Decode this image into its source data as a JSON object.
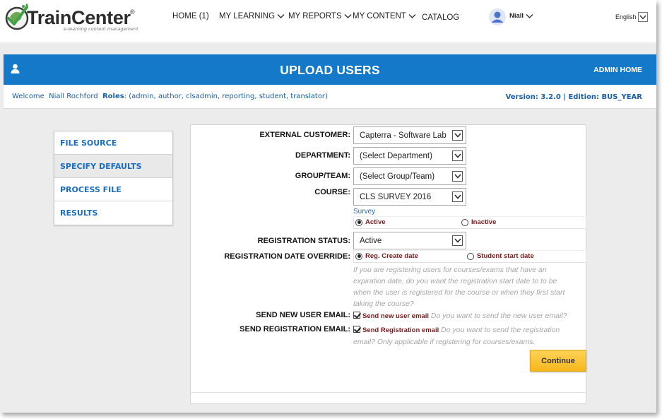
{
  "logo": {
    "wordmark": "TrainCenter",
    "registered": "®",
    "tagline": "e-learning content management"
  },
  "nav": {
    "items": [
      {
        "label": "HOME (1)",
        "dropdown": false
      },
      {
        "label": "MY LEARNING",
        "dropdown": true
      },
      {
        "label": "MY REPORTS",
        "dropdown": true
      },
      {
        "label": "MY CONTENT",
        "dropdown": true
      },
      {
        "label": "CATALOG",
        "dropdown": false
      }
    ],
    "user_name": "Niall",
    "language": "English"
  },
  "banner": {
    "title": "UPLOAD USERS",
    "admin_home": "ADMIN HOME"
  },
  "welcome": {
    "welcome_label": "Welcome",
    "user_full_name": "Niall Rochford",
    "roles_label": "Roles",
    "roles_value": ": (admin, author, clsadmin, reporting, student, translator)",
    "version": "Version: 3.2.0",
    "separator": "|",
    "edition": "Edition: BUS_YEAR"
  },
  "steps": {
    "items": [
      {
        "label": "FILE SOURCE",
        "active": false
      },
      {
        "label": "SPECIFY DEFAULTS",
        "active": true
      },
      {
        "label": "PROCESS FILE",
        "active": false
      },
      {
        "label": "RESULTS",
        "active": false
      }
    ]
  },
  "form": {
    "external_customer": {
      "label": "EXTERNAL CUSTOMER:",
      "value": "Capterra - Software Lab"
    },
    "department": {
      "label": "DEPARTMENT:",
      "value": "(Select Department)"
    },
    "group_team": {
      "label": "GROUP/TEAM:",
      "value": "(Select Group/Team)"
    },
    "course": {
      "label": "COURSE:",
      "value": "CLS SURVEY 2016"
    },
    "survey": {
      "label": "Survey",
      "options": [
        {
          "label": "Active",
          "selected": true
        },
        {
          "label": "Inactive",
          "selected": false
        }
      ]
    },
    "registration_status": {
      "label": "REGISTRATION STATUS:",
      "value": "Active"
    },
    "registration_date_override": {
      "label": "REGISTRATION DATE OVERRIDE:",
      "options": [
        {
          "label": "Reg. Create date",
          "selected": true
        },
        {
          "label": "Student start date",
          "selected": false
        }
      ],
      "help_lines": [
        "If you are registering users for courses/exams that have an",
        "expiration date, do you want the registration start date to to be",
        "when the user is registered for the course or when they first start",
        "taking the course?"
      ]
    },
    "send_new_user_email": {
      "label": "SEND NEW USER EMAIL:",
      "checkbox_label": "Send new user email",
      "checked": true,
      "help": "Do you want to send the new user email?"
    },
    "send_registration_email": {
      "label": "SEND REGISTRATION EMAIL:",
      "checkbox_label": "Send Registration email",
      "checked": true,
      "help_line1": "Do you want to send the registration",
      "help_line2": "email? Only applicable if registering for courses/exams."
    },
    "continue_label": "Continue"
  },
  "colors": {
    "banner_blue": "#1479c8",
    "link_blue": "#1b6dbf",
    "option_red": "#7a1b1b",
    "button_gold": "#f5b81c"
  }
}
